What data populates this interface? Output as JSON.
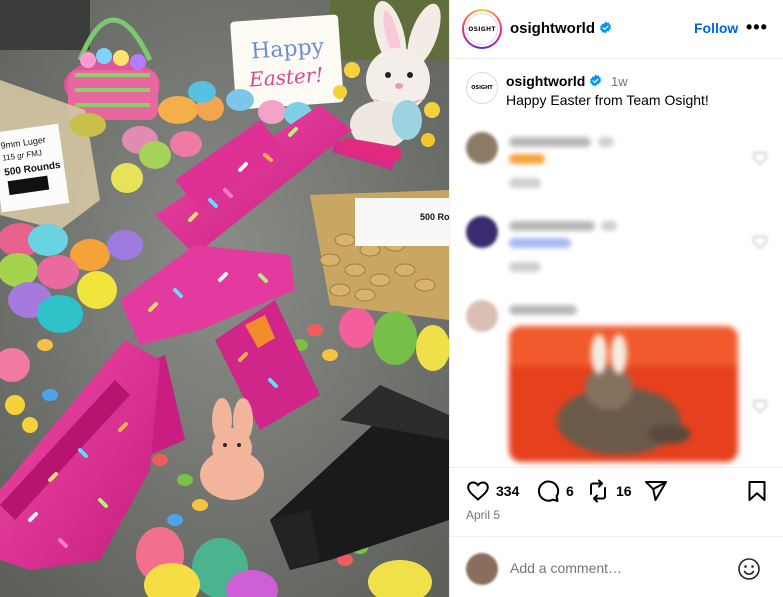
{
  "post_image": {
    "sign_text_1": "Happy",
    "sign_text_2": "Easter!",
    "ammo_label_1": "9mm Luger",
    "ammo_label_2": "115 gr FMJ",
    "ammo_label_3": "500 Rounds",
    "ammo_bag_label": "500 Ro"
  },
  "header": {
    "avatar_text": "OSIGHT",
    "username": "osightworld",
    "follow_label": "Follow",
    "more_label": "•••"
  },
  "caption": {
    "avatar_text": "OSIGHT",
    "username": "osightworld",
    "time": "1w",
    "text": "Happy Easter from Team Osight!"
  },
  "actions": {
    "likes": "334",
    "comments": "6",
    "reposts": "16",
    "date": "April 5"
  },
  "comment_box": {
    "placeholder": "Add a comment…"
  },
  "colors": {
    "accent": "#0064e0",
    "verified": "#0095f6",
    "muted": "#737373",
    "gun_pink": "#e0309a"
  }
}
